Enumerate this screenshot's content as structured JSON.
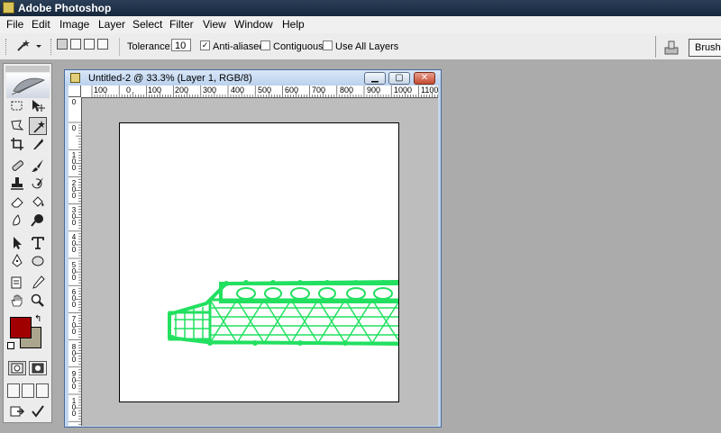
{
  "app": {
    "title": "Adobe Photoshop"
  },
  "menu": [
    "File",
    "Edit",
    "Image",
    "Layer",
    "Select",
    "Filter",
    "View",
    "Window",
    "Help"
  ],
  "options": {
    "tolerance_label": "Tolerance:",
    "tolerance_value": "10",
    "anti_aliased_label": "Anti-aliased",
    "anti_aliased_checked": true,
    "contiguous_label": "Contiguous",
    "contiguous_checked": false,
    "use_all_layers_label": "Use All Layers",
    "use_all_layers_checked": false,
    "brushes_tab": "Brushes"
  },
  "document": {
    "title": "Untitled-2 @ 33.3% (Layer 1, RGB/8)",
    "h_ruler_labels": [
      "100",
      "0",
      "100",
      "200",
      "300",
      "400",
      "500",
      "600",
      "700",
      "800",
      "900",
      "1000",
      "1100"
    ],
    "v_ruler_labels": [
      "0",
      "0",
      "1\n0\n0",
      "2\n0\n0",
      "3\n0\n0",
      "4\n0\n0",
      "5\n0\n0",
      "6\n0\n0",
      "7\n0\n0",
      "8\n0\n0",
      "9\n0\n0",
      "1\n0\n0"
    ]
  },
  "colors": {
    "foreground": "#a10000",
    "background": "#a9a68d",
    "wireframe": "#22e060"
  },
  "tools": [
    "marquee-tool",
    "move-tool",
    "lasso-tool",
    "magic-wand-tool",
    "crop-tool",
    "slice-tool",
    "healing-brush-tool",
    "brush-tool",
    "clone-stamp-tool",
    "history-brush-tool",
    "eraser-tool",
    "paint-bucket-tool",
    "blur-tool",
    "dodge-tool",
    "path-selection-tool",
    "type-tool",
    "pen-tool",
    "shape-tool",
    "notes-tool",
    "eyedropper-tool",
    "hand-tool",
    "zoom-tool"
  ]
}
